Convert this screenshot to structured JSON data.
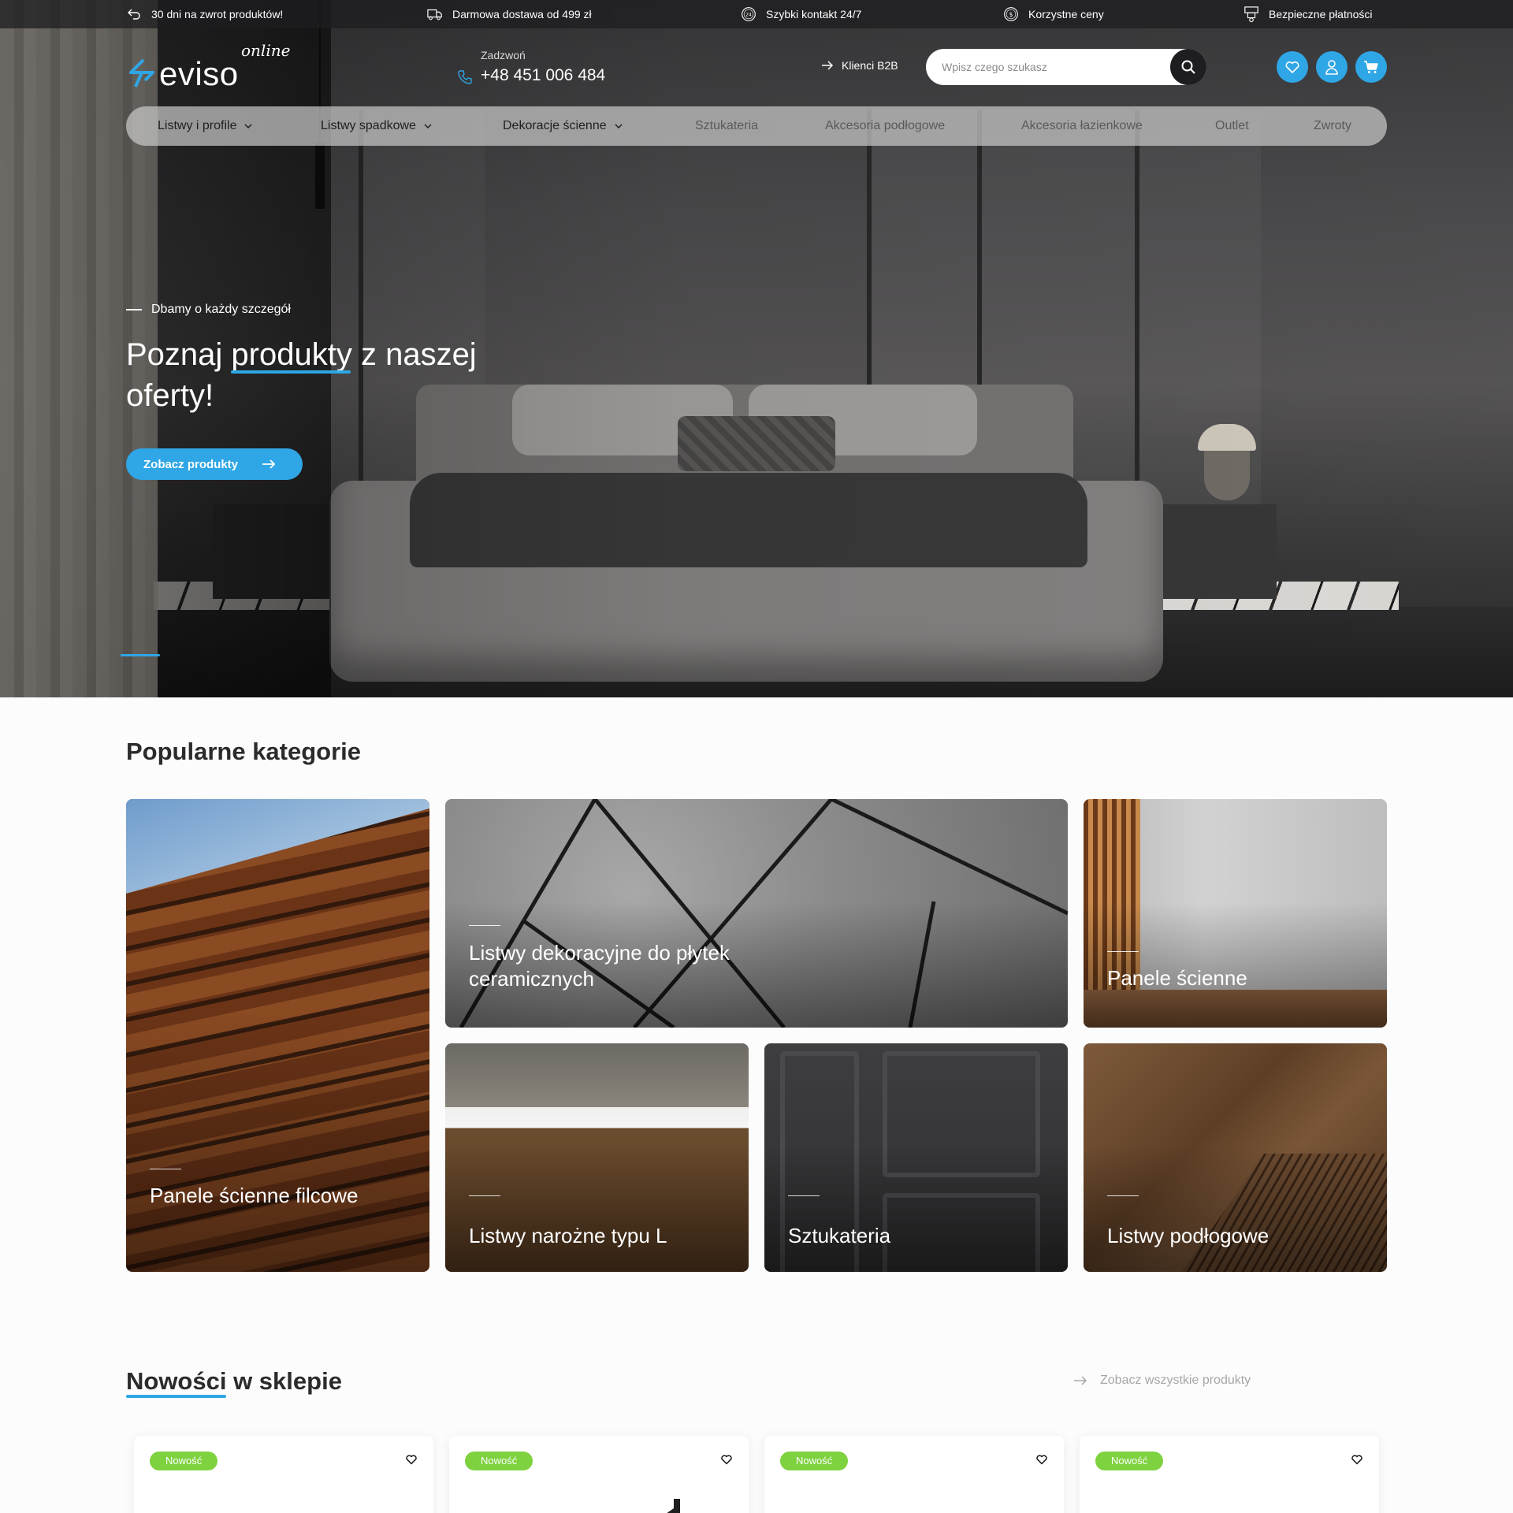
{
  "topbar": {
    "items": [
      {
        "icon": "return-arrow-icon",
        "label": "30 dni na zwrot produktów!"
      },
      {
        "icon": "truck-icon",
        "label": "Darmowa dostawa od 499 zł"
      },
      {
        "icon": "24h-clock-icon",
        "label": "Szybki kontakt 24/7"
      },
      {
        "icon": "coin-icon",
        "label": "Korzystne ceny"
      },
      {
        "icon": "secure-payment-icon",
        "label": "Bezpieczne płatności"
      }
    ]
  },
  "header": {
    "logo_text": "eviso",
    "logo_tagline": "online",
    "phone_label": "Zadzwoń",
    "phone_number": "+48 451 006 484",
    "b2b_label": "Klienci B2B",
    "search_placeholder": "Wpisz czego szukasz"
  },
  "nav": {
    "items": [
      {
        "label": "Listwy i profile",
        "has_dropdown": true
      },
      {
        "label": "Listwy spadkowe",
        "has_dropdown": true
      },
      {
        "label": "Dekoracje ścienne",
        "has_dropdown": true
      },
      {
        "label": "Sztukateria",
        "has_dropdown": false
      },
      {
        "label": "Akcesoria podłogowe",
        "has_dropdown": false
      },
      {
        "label": "Akcesoria łazienkowe",
        "has_dropdown": false
      },
      {
        "label": "Outlet",
        "has_dropdown": false
      },
      {
        "label": "Zwroty",
        "has_dropdown": false
      }
    ]
  },
  "hero": {
    "kicker": "Dbamy o każdy szczegół",
    "title_part1": "Poznaj ",
    "title_highlight": "produkty",
    "title_part2": " z naszej oferty!",
    "cta_label": "Zobacz produkty"
  },
  "categories": {
    "title": "Popularne kategorie",
    "items": [
      {
        "label": "Panele ścienne filcowe"
      },
      {
        "label": "Listwy dekoracyjne do płytek ceramicznych"
      },
      {
        "label": "Panele ścienne"
      },
      {
        "label": "Listwy narożne typu L"
      },
      {
        "label": "Sztukateria"
      },
      {
        "label": "Listwy podłogowe"
      }
    ]
  },
  "new_products": {
    "title_highlight": "Nowości",
    "title_rest": " w sklepie",
    "see_all_label": "Zobacz wszystkie produkty",
    "badge_label": "Nowość",
    "cards": [
      {
        "badge": "Nowość"
      },
      {
        "badge": "Nowość"
      },
      {
        "badge": "Nowość"
      },
      {
        "badge": "Nowość"
      }
    ]
  },
  "colors": {
    "accent": "#2fa6e5",
    "badge_green": "#7ed13f",
    "dark": "#1e1e20"
  }
}
